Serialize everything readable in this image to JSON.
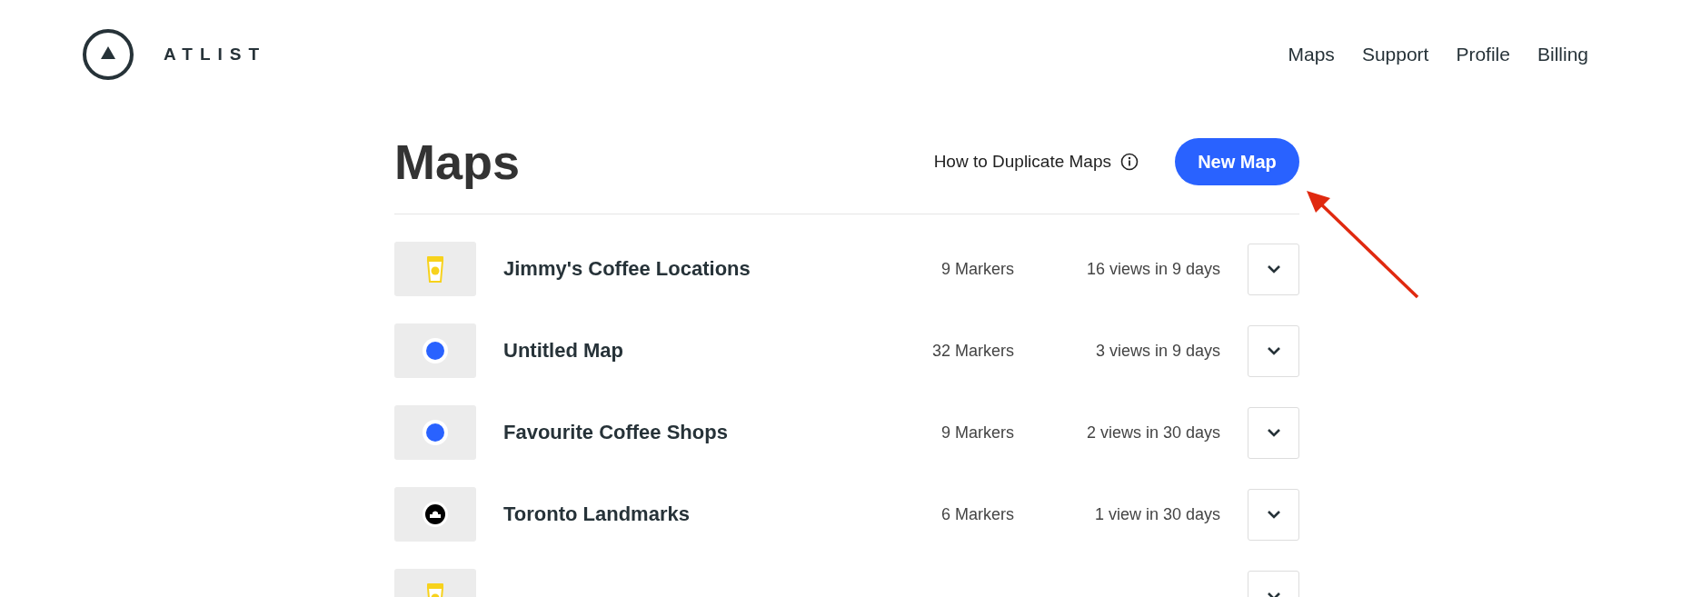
{
  "brand": {
    "name": "ATLIST"
  },
  "nav": [
    {
      "label": "Maps"
    },
    {
      "label": "Support"
    },
    {
      "label": "Profile"
    },
    {
      "label": "Billing"
    }
  ],
  "page": {
    "title": "Maps",
    "help_link": "How to Duplicate Maps",
    "new_button": "New Map"
  },
  "maps": [
    {
      "kind": "cup",
      "name": "Jimmy's Coffee Locations",
      "markers": "9 Markers",
      "views": "16 views in 9 days"
    },
    {
      "kind": "dot",
      "name": "Untitled Map",
      "markers": "32 Markers",
      "views": "3 views in 9 days"
    },
    {
      "kind": "dot",
      "name": "Favourite Coffee Shops",
      "markers": "9 Markers",
      "views": "2 views in 30 days"
    },
    {
      "kind": "landmark",
      "name": "Toronto Landmarks",
      "markers": "6 Markers",
      "views": "1 view in 30 days"
    },
    {
      "kind": "cup"
    }
  ]
}
